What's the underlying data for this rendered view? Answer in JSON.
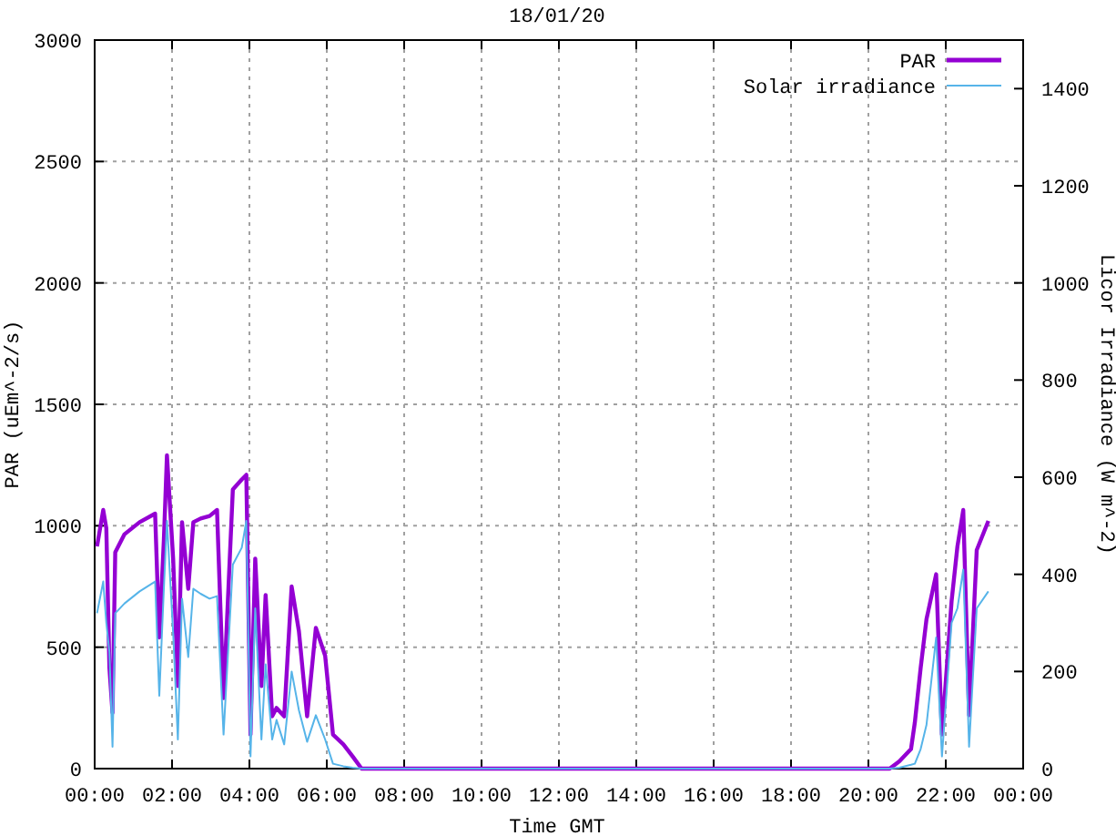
{
  "chart_data": {
    "type": "line",
    "title": "18/01/20",
    "xlabel": "Time GMT",
    "ylabel": "PAR (uEm^-2/s)",
    "y2label": "Licor Irradiance (W m^-2)",
    "grid": true,
    "legend": true,
    "xlim": [
      0,
      24
    ],
    "ylim": [
      0,
      3000
    ],
    "y2lim": [
      0,
      1500
    ],
    "xticks": [
      {
        "value": 0,
        "label": "00:00"
      },
      {
        "value": 2,
        "label": "02:00"
      },
      {
        "value": 4,
        "label": "04:00"
      },
      {
        "value": 6,
        "label": "06:00"
      },
      {
        "value": 8,
        "label": "08:00"
      },
      {
        "value": 10,
        "label": "10:00"
      },
      {
        "value": 12,
        "label": "12:00"
      },
      {
        "value": 14,
        "label": "14:00"
      },
      {
        "value": 16,
        "label": "16:00"
      },
      {
        "value": 18,
        "label": "18:00"
      },
      {
        "value": 20,
        "label": "20:00"
      },
      {
        "value": 22,
        "label": "22:00"
      },
      {
        "value": 24,
        "label": "00:00"
      }
    ],
    "yticks": [
      0,
      500,
      1000,
      1500,
      2000,
      2500,
      3000
    ],
    "y2ticks": [
      0,
      200,
      400,
      600,
      800,
      1000,
      1200,
      1400
    ],
    "x": [
      0.06,
      0.22,
      0.3,
      0.38,
      0.46,
      0.53,
      0.77,
      1.16,
      1.56,
      1.67,
      1.79,
      1.87,
      2.03,
      2.15,
      2.26,
      2.42,
      2.55,
      2.74,
      2.97,
      3.16,
      3.33,
      3.57,
      3.8,
      3.92,
      4.03,
      4.15,
      4.31,
      4.42,
      4.59,
      4.7,
      4.9,
      5.09,
      5.28,
      5.49,
      5.72,
      5.96,
      6.16,
      6.43,
      6.67,
      6.9,
      10,
      15,
      20.55,
      20.8,
      21.1,
      21.2,
      21.35,
      21.5,
      21.75,
      21.9,
      22.15,
      22.3,
      22.45,
      22.6,
      22.8,
      23.1
    ],
    "series": [
      {
        "name": "PAR",
        "color": "#9400d3",
        "values": [
          915,
          1065,
          990,
          415,
          230,
          890,
          965,
          1015,
          1050,
          540,
          940,
          1290,
          865,
          340,
          1015,
          740,
          1015,
          1030,
          1040,
          1065,
          290,
          1150,
          1190,
          1210,
          140,
          865,
          340,
          715,
          215,
          250,
          215,
          750,
          565,
          215,
          580,
          465,
          140,
          100,
          50,
          0,
          0,
          0,
          0,
          30,
          80,
          190,
          415,
          615,
          800,
          140,
          690,
          915,
          1065,
          220,
          900,
          1020
        ]
      },
      {
        "name": "Solar irradiance",
        "color": "#56b4e9",
        "axis": "y2",
        "values": [
          320,
          385,
          300,
          240,
          45,
          320,
          340,
          365,
          385,
          150,
          370,
          510,
          280,
          60,
          350,
          230,
          370,
          360,
          350,
          355,
          70,
          420,
          455,
          510,
          25,
          330,
          60,
          215,
          60,
          100,
          50,
          200,
          120,
          55,
          110,
          60,
          10,
          5,
          2,
          0,
          0,
          0,
          0,
          2,
          8,
          10,
          40,
          90,
          270,
          25,
          300,
          330,
          410,
          45,
          330,
          365
        ]
      }
    ]
  }
}
